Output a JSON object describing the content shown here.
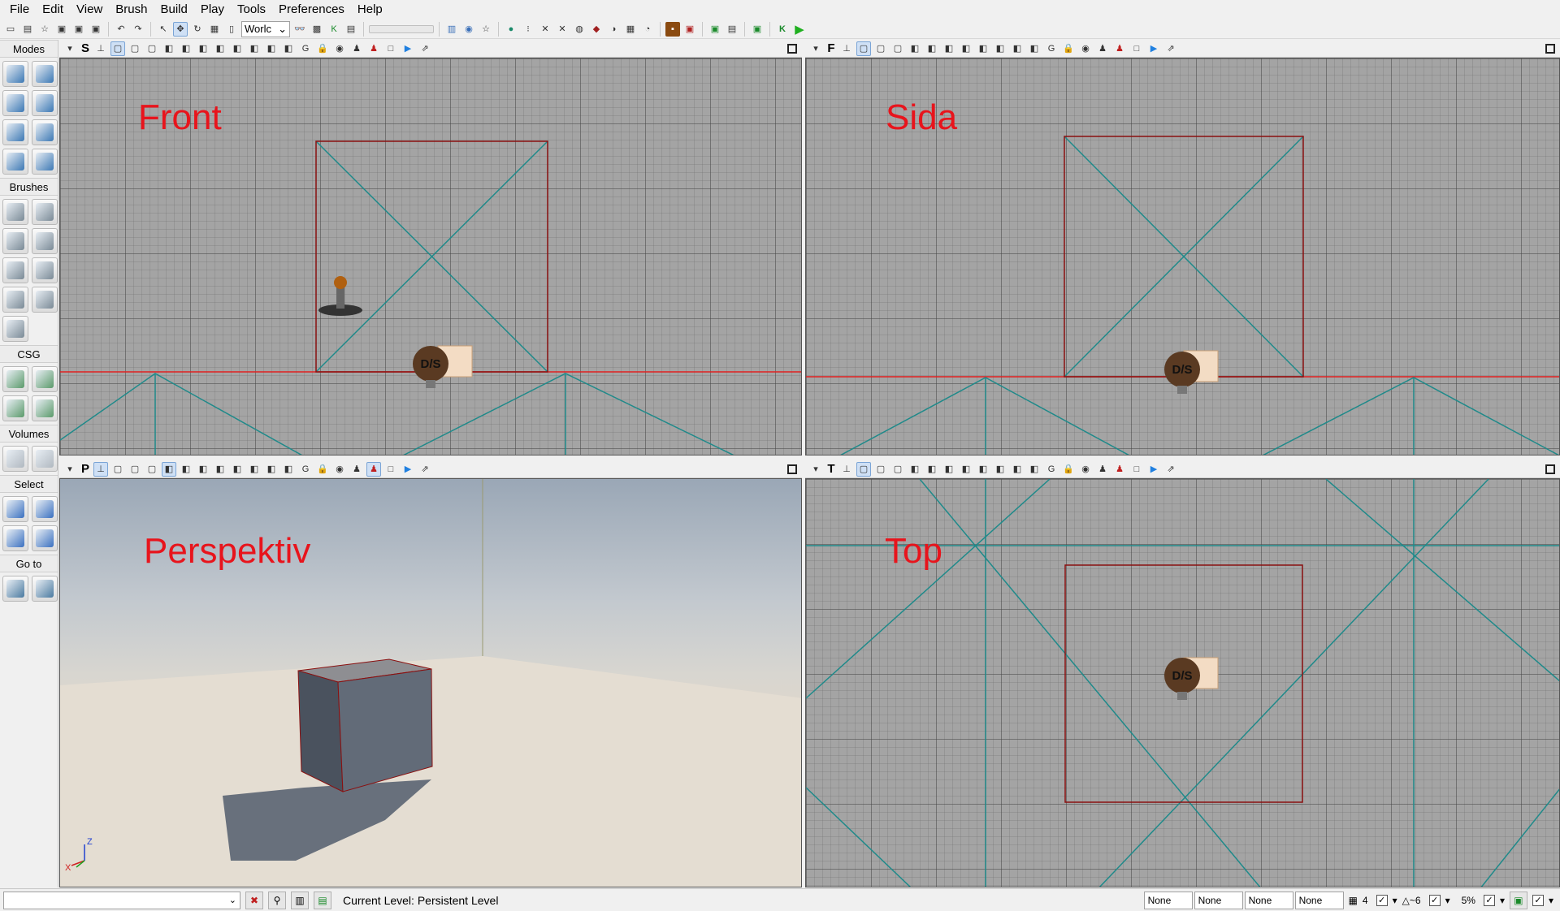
{
  "menu": [
    "File",
    "Edit",
    "View",
    "Brush",
    "Build",
    "Play",
    "Tools",
    "Preferences",
    "Help"
  ],
  "toolbar": {
    "coordinate_space": "Worlc"
  },
  "modes_panel": {
    "sections": [
      {
        "title": "Modes",
        "buttons": [
          "camera-mode-icon",
          "geometry-mode-icon",
          "terrain-mode-icon",
          "texture-align-icon",
          "mesh-paint-icon",
          "static-mesh-icon",
          "landscape-icon",
          "foliage-icon"
        ]
      },
      {
        "title": "Brushes",
        "buttons": [
          "cube-brush-icon",
          "cone-brush-icon",
          "curved-stair-icon",
          "cylinder-brush-icon",
          "linear-stair-icon",
          "sheet-brush-icon",
          "spiral-stair-icon",
          "sphere-brush-icon",
          "volumetric-brush-icon"
        ]
      },
      {
        "title": "CSG",
        "buttons": [
          "csg-add-icon",
          "csg-subtract-icon",
          "csg-intersect-icon",
          "csg-deintersect-icon"
        ]
      },
      {
        "title": "Volumes",
        "buttons": [
          "add-volume-icon",
          "volume-list-icon"
        ]
      },
      {
        "title": "Select",
        "buttons": [
          "show-selected-icon",
          "hide-selected-icon",
          "select-inside-icon",
          "invert-selection-icon"
        ]
      },
      {
        "title": "Go to",
        "buttons": [
          "goto-actor-icon",
          "goto-builder-brush-icon"
        ]
      }
    ]
  },
  "viewports": {
    "front": {
      "letter": "S",
      "label": "Front"
    },
    "side": {
      "letter": "F",
      "label": "Sida"
    },
    "perspective": {
      "letter": "P",
      "label": "Perspektiv"
    },
    "top": {
      "letter": "T",
      "label": "Top"
    }
  },
  "actor_labels": {
    "light": "D/S"
  },
  "axis_labels": {
    "z": "Z",
    "x": "X"
  },
  "statusbar": {
    "level_label": "Current Level:",
    "level_name": "Persistent Level",
    "fields": [
      "None",
      "None",
      "None",
      "None"
    ],
    "grid_value": "4",
    "rotation_value": "6",
    "scale_value": "5%"
  },
  "colors": {
    "label_red": "#e8141c",
    "brush_outline": "#8a1010",
    "teal_lines": "#1f8a8a",
    "grid_bg": "#a4a4a4"
  }
}
